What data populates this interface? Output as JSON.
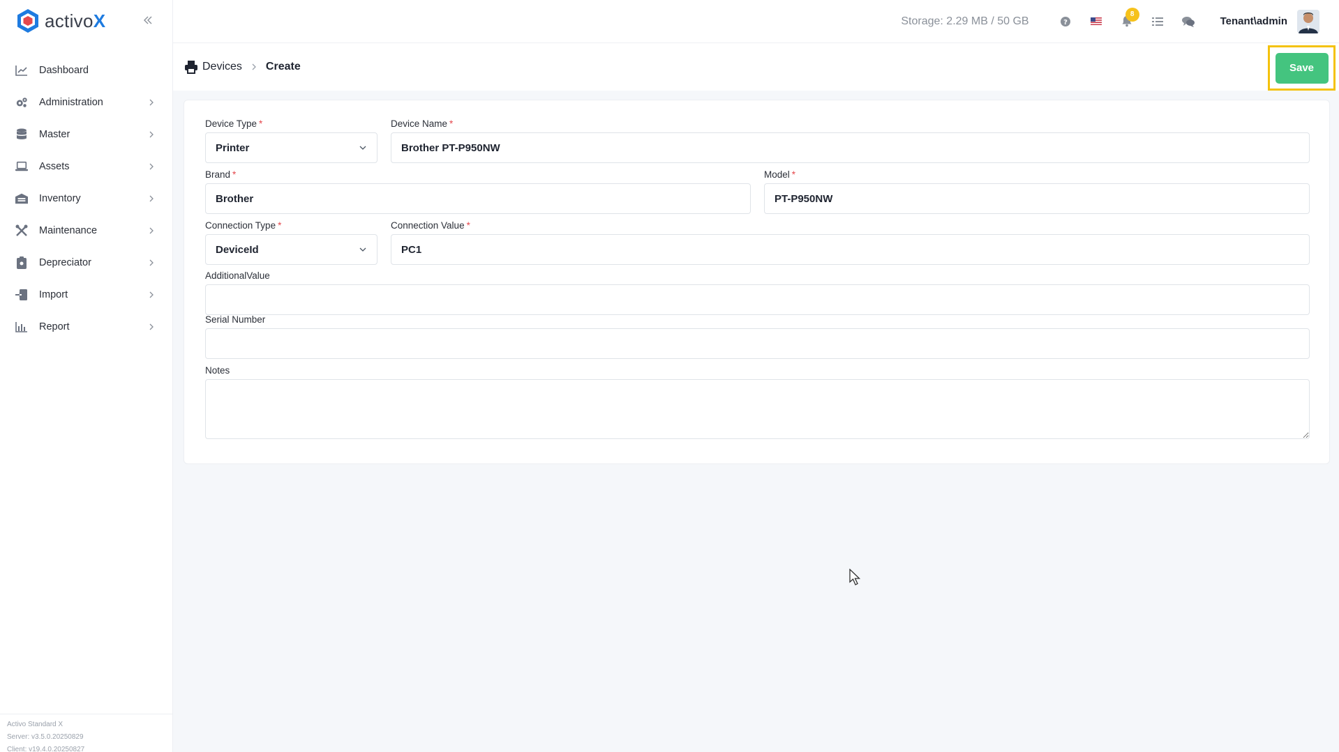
{
  "app": {
    "logo_text_main": "activo",
    "logo_text_accent": "X"
  },
  "sidebar": {
    "items": [
      {
        "label": "Dashboard",
        "icon": "chart-line-icon",
        "has_children": false
      },
      {
        "label": "Administration",
        "icon": "gears-icon",
        "has_children": true
      },
      {
        "label": "Master",
        "icon": "database-icon",
        "has_children": true
      },
      {
        "label": "Assets",
        "icon": "laptop-icon",
        "has_children": true
      },
      {
        "label": "Inventory",
        "icon": "warehouse-icon",
        "has_children": true
      },
      {
        "label": "Maintenance",
        "icon": "tools-icon",
        "has_children": true
      },
      {
        "label": "Depreciator",
        "icon": "clipboard-icon",
        "has_children": true
      },
      {
        "label": "Import",
        "icon": "import-icon",
        "has_children": true
      },
      {
        "label": "Report",
        "icon": "bar-chart-icon",
        "has_children": true
      }
    ],
    "footer": {
      "product": "Activo Standard X",
      "server": "Server: v3.5.0.20250829",
      "client": "Client: v19.4.0.20250827"
    }
  },
  "topbar": {
    "storage": "Storage: 2.29 MB / 50 GB",
    "notification_count": "8",
    "user": "Tenant\\admin"
  },
  "breadcrumb": {
    "parent": "Devices",
    "current": "Create"
  },
  "actions": {
    "save_label": "Save"
  },
  "form": {
    "device_type": {
      "label": "Device Type",
      "value": "Printer"
    },
    "device_name": {
      "label": "Device Name",
      "value": "Brother PT-P950NW"
    },
    "brand": {
      "label": "Brand",
      "value": "Brother"
    },
    "model": {
      "label": "Model",
      "value": "PT-P950NW"
    },
    "connection_type": {
      "label": "Connection Type",
      "value": "DeviceId"
    },
    "connection_value": {
      "label": "Connection Value",
      "value": "PC1"
    },
    "additional_value": {
      "label": "AdditionalValue",
      "value": ""
    },
    "serial_number": {
      "label": "Serial Number",
      "value": ""
    },
    "notes": {
      "label": "Notes",
      "value": ""
    }
  },
  "colors": {
    "accent": "#1e7be0",
    "save_green": "#44c47f",
    "highlight": "#f4c20d",
    "required": "#e5484d"
  }
}
